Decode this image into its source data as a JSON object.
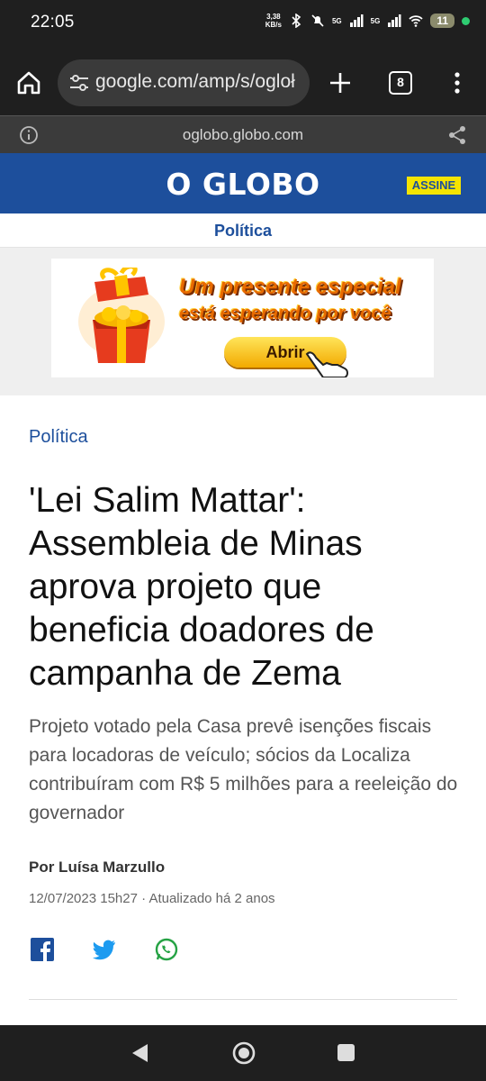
{
  "status_bar": {
    "time": "22:05",
    "speed_value": "3,38",
    "speed_unit": "KB/s",
    "network1": "5G",
    "network2": "5G",
    "battery": "11"
  },
  "browser": {
    "url": "google.com/amp/s/ogloł",
    "tab_count": "8",
    "amp_domain": "oglobo.globo.com"
  },
  "site": {
    "logo": "O GLOBO",
    "subscribe_label": "ASSINE",
    "section_label": "Política",
    "brand_color": "#1d4f9c",
    "accent_color": "#f5e400"
  },
  "ad": {
    "line1": "Um presente especial",
    "line2": "está esperando por você",
    "button_label": "Abrir"
  },
  "article": {
    "kicker": "Política",
    "headline": "'Lei Salim Mattar': Assembleia de Minas aprova projeto que beneficia doadores de campanha de Zema",
    "subtitle": "Projeto votado pela Casa prevê isenções fiscais para locadoras de veículo; sócios da Localiza contribuíram com R$ 5 milhões para a reeleição do governador",
    "byline": "Por Luísa Marzullo",
    "dateline": "12/07/2023 15h27 · Atualizado há 2 anos"
  },
  "share": {
    "icons": [
      "facebook-icon",
      "twitter-icon",
      "whatsapp-icon"
    ]
  }
}
